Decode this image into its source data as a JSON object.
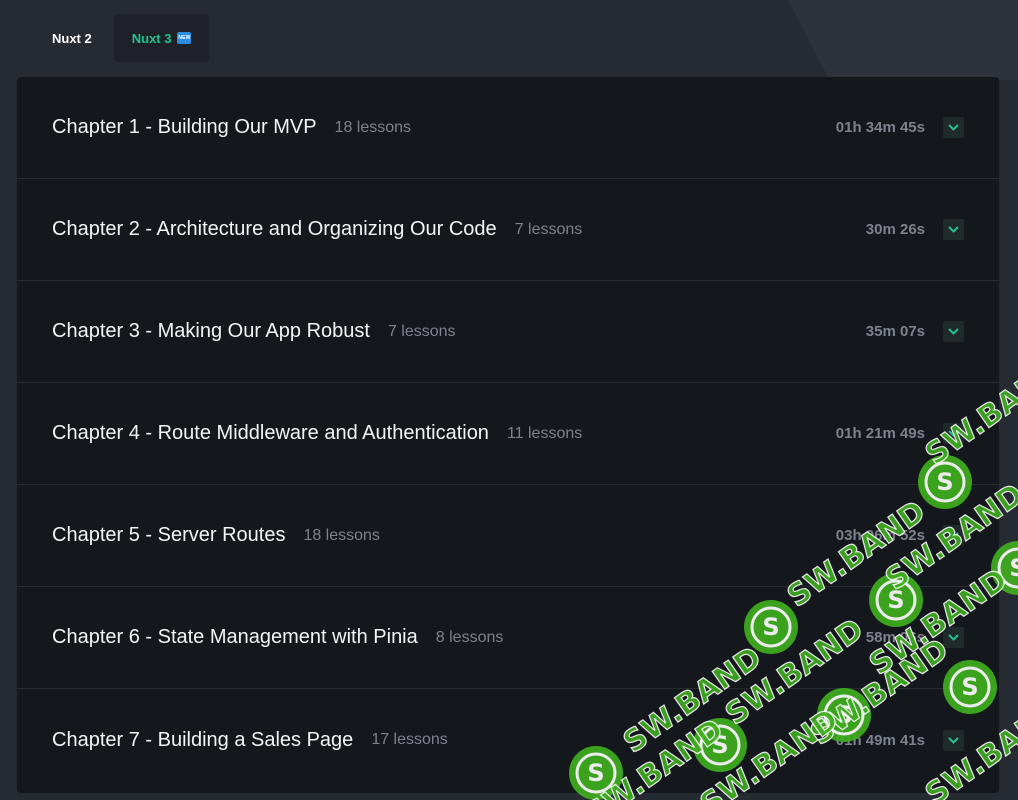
{
  "tabs": [
    {
      "label": "Nuxt 2",
      "active": false
    },
    {
      "label": "Nuxt 3",
      "active": true,
      "badge": "NEW"
    }
  ],
  "chapters": [
    {
      "title": "Chapter 1 - Building Our MVP",
      "lessons": "18 lessons",
      "duration": "01h 34m 45s"
    },
    {
      "title": "Chapter 2 - Architecture and Organizing Our Code",
      "lessons": "7 lessons",
      "duration": "30m 26s"
    },
    {
      "title": "Chapter 3 - Making Our App Robust",
      "lessons": "7 lessons",
      "duration": "35m 07s"
    },
    {
      "title": "Chapter 4 - Route Middleware and Authentication",
      "lessons": "11 lessons",
      "duration": "01h 21m 49s"
    },
    {
      "title": "Chapter 5 - Server Routes",
      "lessons": "18 lessons",
      "duration": "03h 06m 52s"
    },
    {
      "title": "Chapter 6 - State Management with Pinia",
      "lessons": "8 lessons",
      "duration": "58m 06s"
    },
    {
      "title": "Chapter 7 - Building a Sales Page",
      "lessons": "17 lessons",
      "duration": "01h 49m 41s"
    }
  ],
  "watermark": {
    "text": "SW.BAND",
    "logo_letter": "S"
  },
  "colors": {
    "accent": "#22c38e",
    "panel": "#14171c",
    "background": "#262a31",
    "muted_text": "#7d838c",
    "watermark": "#3fae1f"
  },
  "icons": {
    "expand": "chevron-down-icon",
    "new_badge": "new-badge-icon"
  }
}
